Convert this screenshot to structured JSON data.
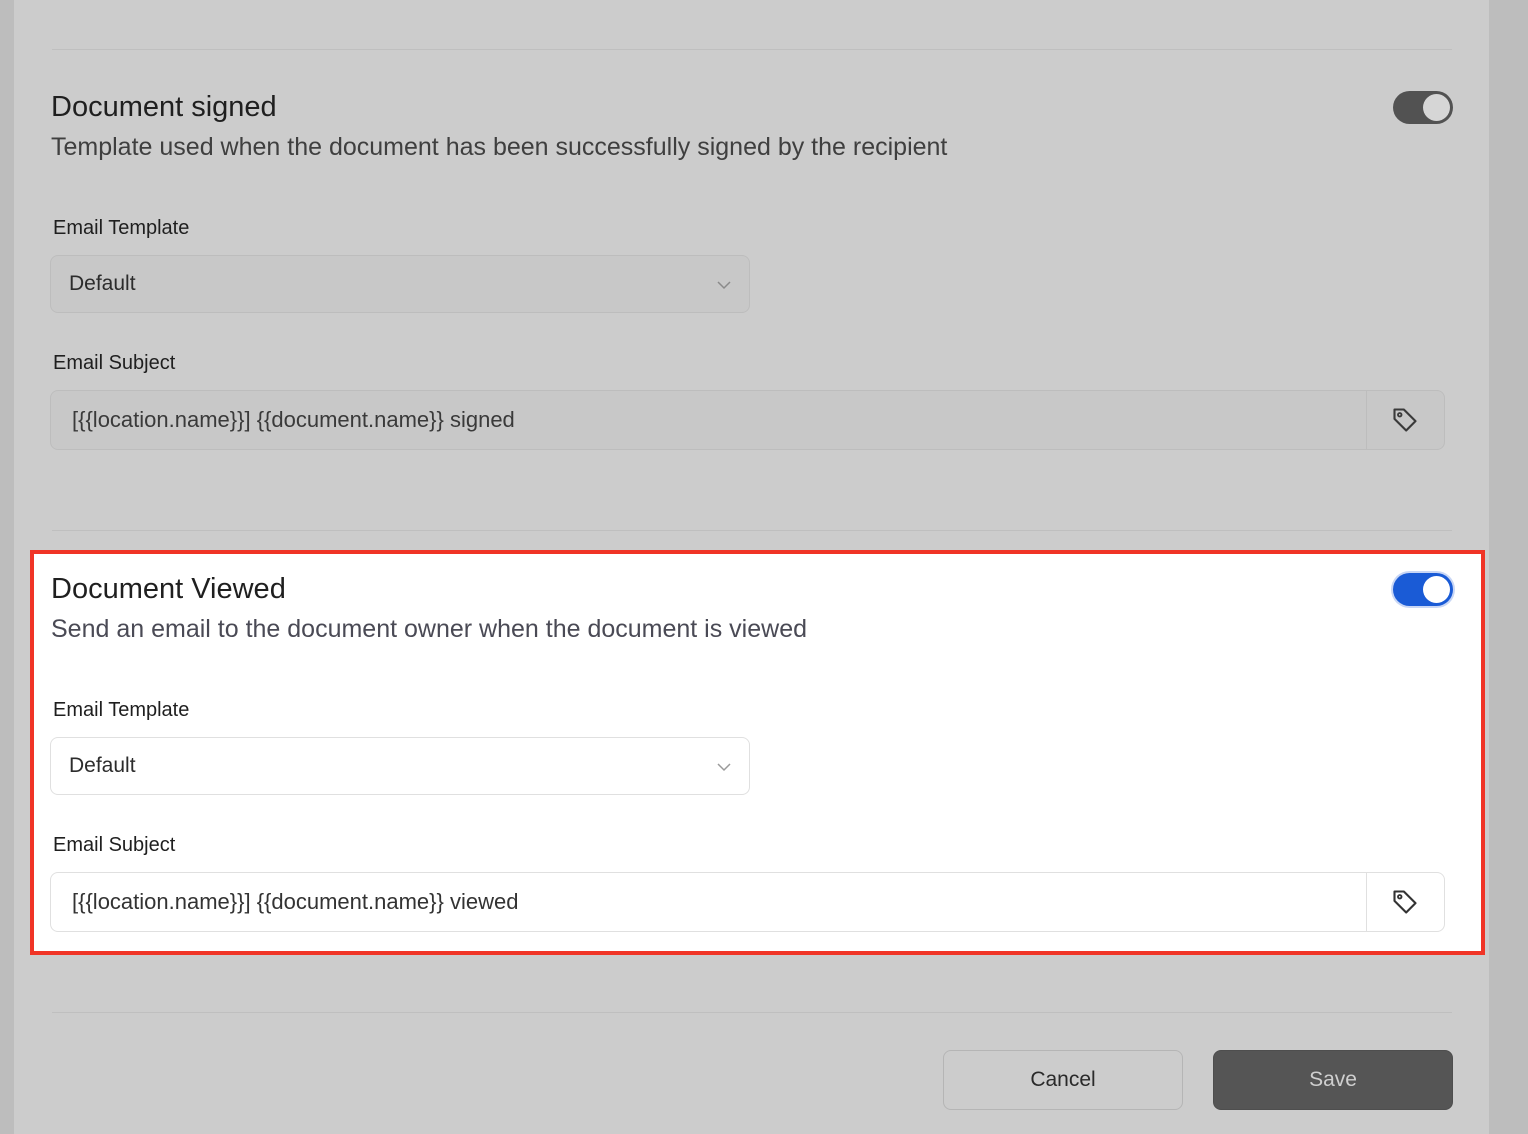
{
  "sections": [
    {
      "title": "Document signed",
      "description": "Template used when the document has been successfully signed by the recipient",
      "enabled": true,
      "template_label": "Email Template",
      "template_value": "Default",
      "subject_label": "Email Subject",
      "subject_value": "[{{location.name}}] {{document.name}} signed"
    },
    {
      "title": "Document Viewed",
      "description": "Send an email to the document owner when the document is viewed",
      "enabled": true,
      "template_label": "Email Template",
      "template_value": "Default",
      "subject_label": "Email Subject",
      "subject_value": "[{{location.name}}] {{document.name}} viewed"
    }
  ],
  "actions": {
    "cancel_label": "Cancel",
    "save_label": "Save"
  },
  "icons": {
    "tag": "tag-icon",
    "chevron": "chevron-down-icon"
  },
  "colors": {
    "toggle_on": "#1a5bd6",
    "highlight_border": "#f03426",
    "save_button": "#555555"
  }
}
